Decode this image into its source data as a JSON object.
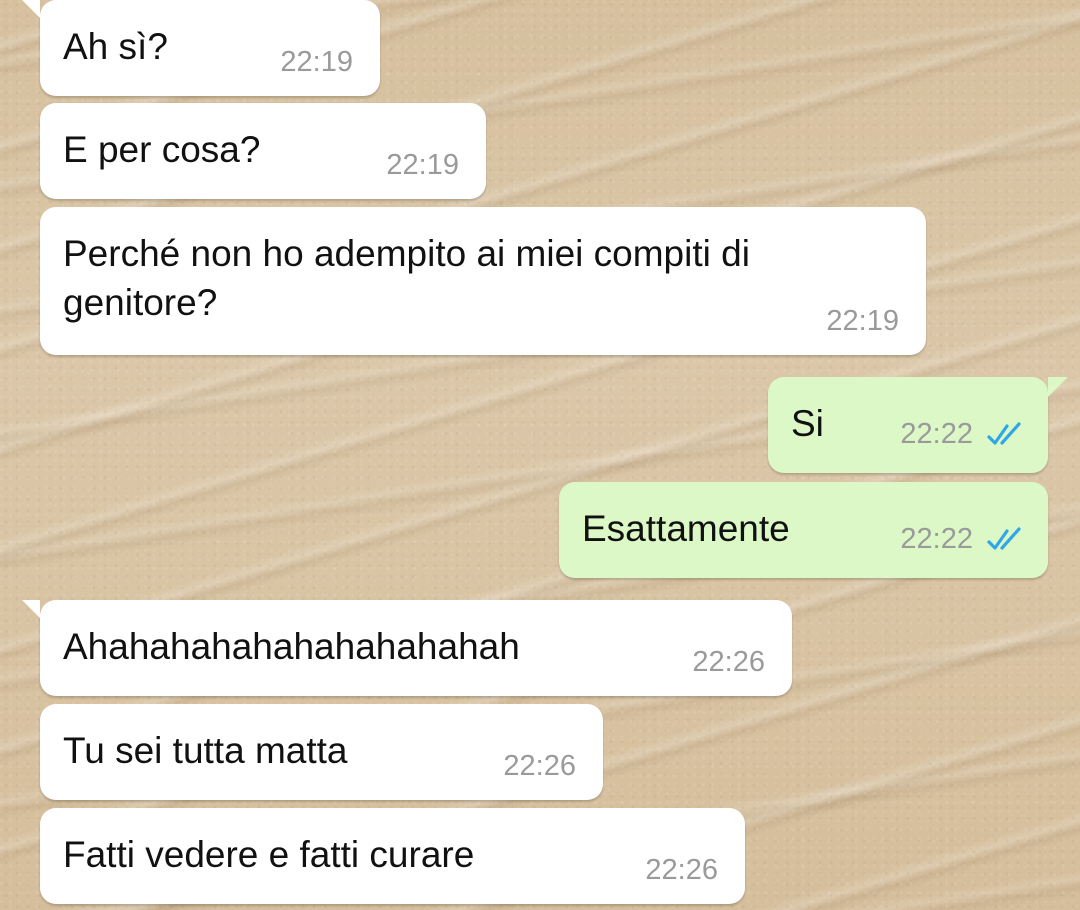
{
  "messages": [
    {
      "text": "Ah sì?",
      "time": "22:19",
      "direction": "incoming"
    },
    {
      "text": "E per cosa?",
      "time": "22:19",
      "direction": "incoming"
    },
    {
      "text": "Perché non ho adempito ai miei compiti di genitore?",
      "time": "22:19",
      "direction": "incoming"
    },
    {
      "text": "Si",
      "time": "22:22",
      "direction": "outgoing",
      "status_icon": "double-check-read-icon"
    },
    {
      "text": "Esattamente",
      "time": "22:22",
      "direction": "outgoing",
      "status_icon": "double-check-read-icon"
    },
    {
      "text": "Ahahahahahahahahahahah",
      "time": "22:26",
      "direction": "incoming"
    },
    {
      "text": "Tu sei tutta matta",
      "time": "22:26",
      "direction": "incoming"
    },
    {
      "text": "Fatti vedere e fatti curare",
      "time": "22:26",
      "direction": "incoming"
    }
  ],
  "colors": {
    "incoming_bubble": "#ffffff",
    "outgoing_bubble": "#dcf8c6",
    "message_text": "#111111",
    "timestamp": "#9a9a9a",
    "read_tick": "#2fa7e7",
    "wallpaper": "#d8c3a2"
  }
}
